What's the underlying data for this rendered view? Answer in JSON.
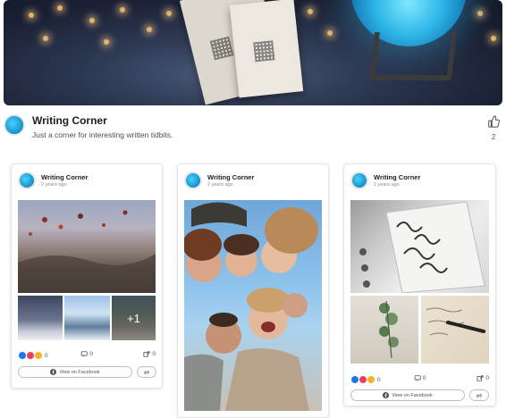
{
  "page": {
    "name": "Writing Corner",
    "description": "Just a corner for interesting written tidbits.",
    "like_count": "2"
  },
  "posts": [
    {
      "author": "Writing Corner",
      "time": "2 years ago",
      "more_photos": "+1",
      "reactions": "0",
      "comments": "0",
      "shares": "0",
      "fb_button": "View on Facebook"
    },
    {
      "author": "Writing Corner",
      "time": "2 years ago"
    },
    {
      "author": "Writing Corner",
      "time": "2 years ago",
      "reactions": "0",
      "comments": "0",
      "shares": "0",
      "fb_button": "View on Facebook"
    }
  ],
  "colors": {
    "like_blue": "#1877f2",
    "love_red": "#f33e58",
    "haha_yellow": "#f7b125",
    "avatar_blue": "#1f9fd6"
  }
}
